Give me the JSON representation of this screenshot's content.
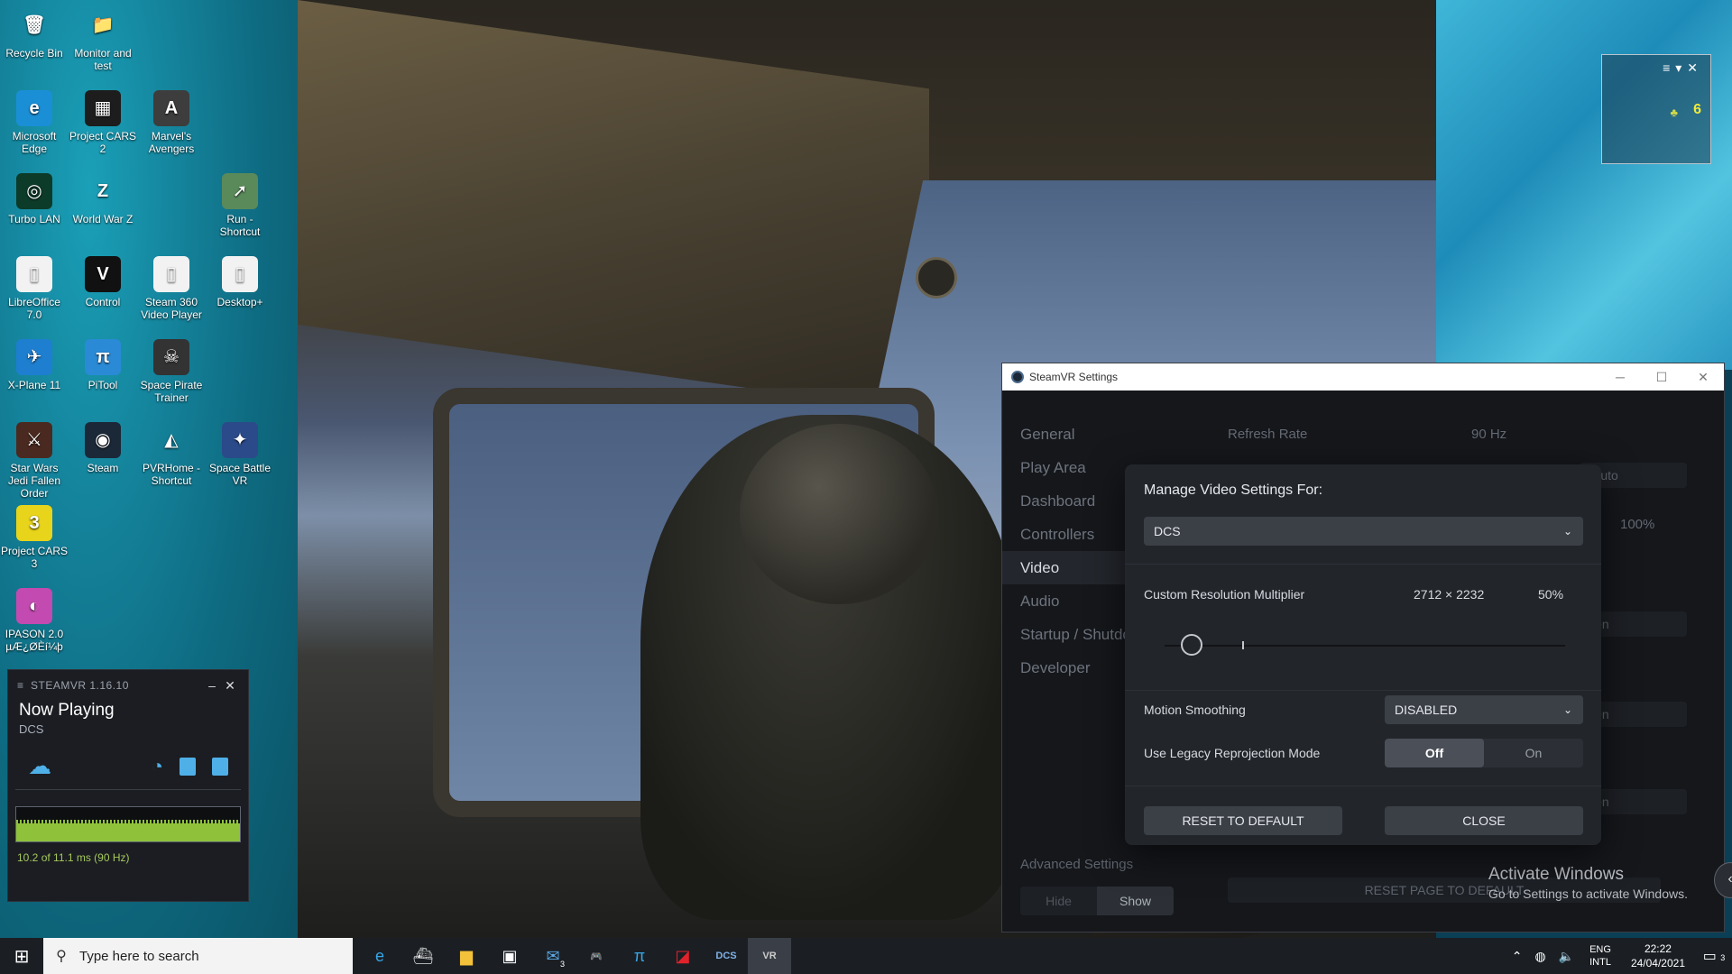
{
  "desktop": {
    "icons": [
      {
        "label": "Recycle Bin",
        "glyph": "🗑",
        "bg": "transparent"
      },
      {
        "label": "Monitor and test",
        "glyph": "📁",
        "bg": "transparent"
      },
      {
        "label": "Microsoft Edge",
        "glyph": "e",
        "bg": "#1a8fd6"
      },
      {
        "label": "Project CARS 2",
        "glyph": "▦",
        "bg": "#1d1d1d"
      },
      {
        "label": "Marvel's Avengers",
        "glyph": "A",
        "bg": "#3d3d3d"
      },
      {
        "label": "Turbo LAN",
        "glyph": "◎",
        "bg": "#0d3b2a"
      },
      {
        "label": "World War Z",
        "glyph": "Z",
        "bg": "transparent"
      },
      {
        "label": "Run - Shortcut",
        "glyph": "➚",
        "bg": "#5a8a5a"
      },
      {
        "label": "LibreOffice 7.0",
        "glyph": "▯",
        "bg": "#f2f2f2"
      },
      {
        "label": "Control",
        "glyph": "V",
        "bg": "#111"
      },
      {
        "label": "Steam 360 Video Player",
        "glyph": "▯",
        "bg": "#f2f2f2"
      },
      {
        "label": "Desktop+",
        "glyph": "▯",
        "bg": "#f2f2f2"
      },
      {
        "label": "X-Plane 11",
        "glyph": "✈",
        "bg": "#1e7fd0"
      },
      {
        "label": "PiTool",
        "glyph": "π",
        "bg": "#2a8ad6"
      },
      {
        "label": "Space Pirate Trainer",
        "glyph": "☠",
        "bg": "#333"
      },
      {
        "label": "Star Wars Jedi Fallen Order",
        "glyph": "⚔",
        "bg": "#4a2a20"
      },
      {
        "label": "Steam",
        "glyph": "◉",
        "bg": "#1b2838"
      },
      {
        "label": "PVRHome - Shortcut",
        "glyph": "◭",
        "bg": "transparent"
      },
      {
        "label": "Space Battle VR",
        "glyph": "✦",
        "bg": "#2b4a8a"
      },
      {
        "label": "Project CARS 3",
        "glyph": "3",
        "bg": "#e8d41a"
      },
      {
        "label": "IPASON 2.0 µÆ¿ØÈí¼þ",
        "glyph": "◐",
        "bg": "#c24ab0"
      }
    ]
  },
  "steamvr_mini": {
    "title": "STEAMVR 1.16.10",
    "minimize": "–",
    "close": "✕",
    "now_playing": "Now Playing",
    "game": "DCS",
    "timing": "10.2 of 11.1 ms (90 Hz)"
  },
  "overlay": {
    "controls": "≡▾✕",
    "count": "6"
  },
  "settings": {
    "title": "SteamVR Settings",
    "nav": [
      "General",
      "Play Area",
      "Dashboard",
      "Controllers",
      "Video",
      "Audio",
      "Startup / Shutdown",
      "Developer"
    ],
    "active_nav": "Video",
    "bg_refresh_label": "Refresh Rate",
    "bg_refresh_value": "90 Hz",
    "bg_auto": "Auto",
    "bg_percent": "100%",
    "bg_on1": "On",
    "bg_on2": "On",
    "bg_on3": "On",
    "bg_reset": "RESET PAGE TO DEFAULT",
    "advanced_label": "Advanced Settings",
    "advanced_hide": "Hide",
    "advanced_show": "Show"
  },
  "modal": {
    "title": "Manage Video Settings For:",
    "app_selected": "DCS",
    "resolution_label": "Custom Resolution Multiplier",
    "resolution_value": "2712 × 2232",
    "resolution_percent": "50%",
    "slider_percent": 50,
    "motion_label": "Motion Smoothing",
    "motion_value": "DISABLED",
    "legacy_label": "Use Legacy Reprojection Mode",
    "legacy_off": "Off",
    "legacy_on": "On",
    "reset_btn": "RESET TO DEFAULT",
    "close_btn": "CLOSE"
  },
  "windows_activation": {
    "line1": "Activate Windows",
    "line2": "Go to Settings to activate Windows."
  },
  "taskbar": {
    "search_placeholder": "Type here to search",
    "apps": [
      {
        "name": "edge-icon",
        "glyph": "e",
        "color": "#35a7e8"
      },
      {
        "name": "steam-vr-boat-icon",
        "glyph": "⛴",
        "color": "#ddd"
      },
      {
        "name": "file-explorer-icon",
        "glyph": "▆",
        "color": "#f3c13a"
      },
      {
        "name": "store-icon",
        "glyph": "▣",
        "color": "#fff"
      },
      {
        "name": "mail-icon",
        "glyph": "✉",
        "color": "#5aa9e6",
        "badge": "3"
      },
      {
        "name": "gamepad-icon",
        "glyph": "🎮",
        "color": "#ccc"
      },
      {
        "name": "pitool-icon",
        "glyph": "π",
        "color": "#35a7e8"
      },
      {
        "name": "amd-icon",
        "glyph": "◪",
        "color": "#e0222a"
      },
      {
        "name": "dcs-icon",
        "glyph": "DCS",
        "color": "#7fb3e8"
      },
      {
        "name": "steamvr-icon",
        "glyph": "VR",
        "color": "#ccc",
        "active": true
      }
    ],
    "lang_top": "ENG",
    "lang_bottom": "INTL",
    "time": "22:22",
    "date": "24/04/2021",
    "notifications_count": "3"
  }
}
